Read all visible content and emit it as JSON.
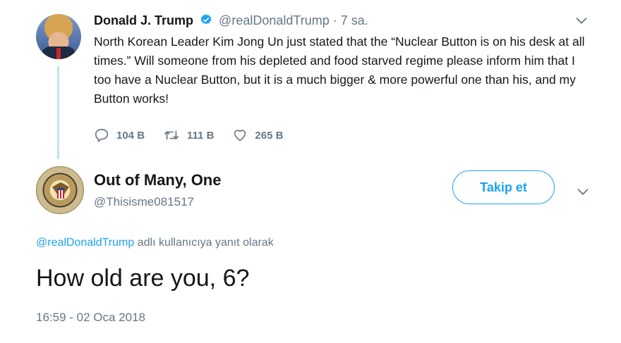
{
  "parent_tweet": {
    "name": "Donald J. Trump",
    "handle": "@realDonaldTrump",
    "separator": "·",
    "time": "7 sa.",
    "text": "North Korean Leader Kim Jong Un just stated that the “Nuclear Button is on his desk at all times.” Will someone from his depleted and food starved regime please inform him that I too have a Nuclear Button, but it is a much bigger & more powerful one than his, and my Button works!",
    "reply_count": "104 B",
    "retweet_count": "111 B",
    "like_count": "265 B",
    "verified_color": "#1da1f2"
  },
  "reply_tweet": {
    "name": "Out of Many, One",
    "handle": "@Thisisme081517",
    "follow_label": "Takip et",
    "context_link": "@realDonaldTrump",
    "context_text": " adlı kullanıcıya yanıt olarak",
    "text": "How old are you, 6?",
    "timestamp": "16:59 - 02 Oca 2018"
  },
  "icons": {
    "reply": "reply-icon",
    "retweet": "retweet-icon",
    "like": "heart-icon",
    "more": "chevron-down-icon",
    "verified": "verified-badge-icon"
  },
  "colors": {
    "accent": "#1da1f2",
    "muted": "#657786",
    "thread_line": "#bfe3fa"
  }
}
